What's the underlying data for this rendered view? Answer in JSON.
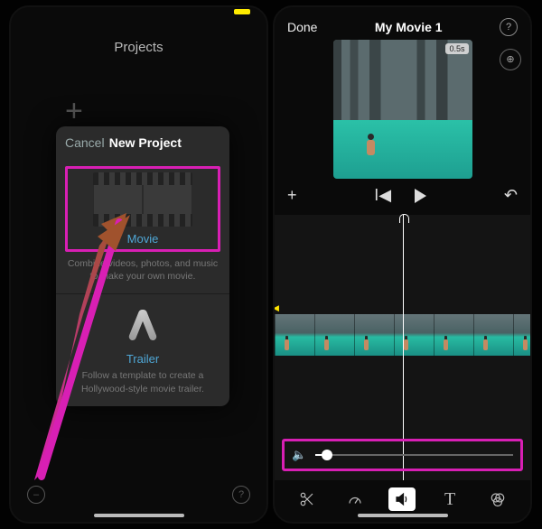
{
  "annotation": {
    "highlight_targets": [
      "movie-option",
      "volume-slider"
    ],
    "arrow_points_to": "movie-option"
  },
  "left_screen": {
    "header_title": "Projects",
    "sheet": {
      "cancel_label": "Cancel",
      "title": "New Project",
      "movie": {
        "title": "Movie",
        "description": "Combine videos, photos, and music to make your own movie."
      },
      "trailer": {
        "title": "Trailer",
        "description": "Follow a template to create a Hollywood-style movie trailer."
      }
    }
  },
  "right_screen": {
    "done_label": "Done",
    "project_title": "My Movie 1",
    "clip_duration_label": "0.5s",
    "volume_level_percent": 6,
    "toolbar": {
      "cut": "Split",
      "speed": "Speed",
      "audio": "Volume",
      "text": "Titles",
      "filters": "Filters",
      "active": "audio"
    }
  }
}
